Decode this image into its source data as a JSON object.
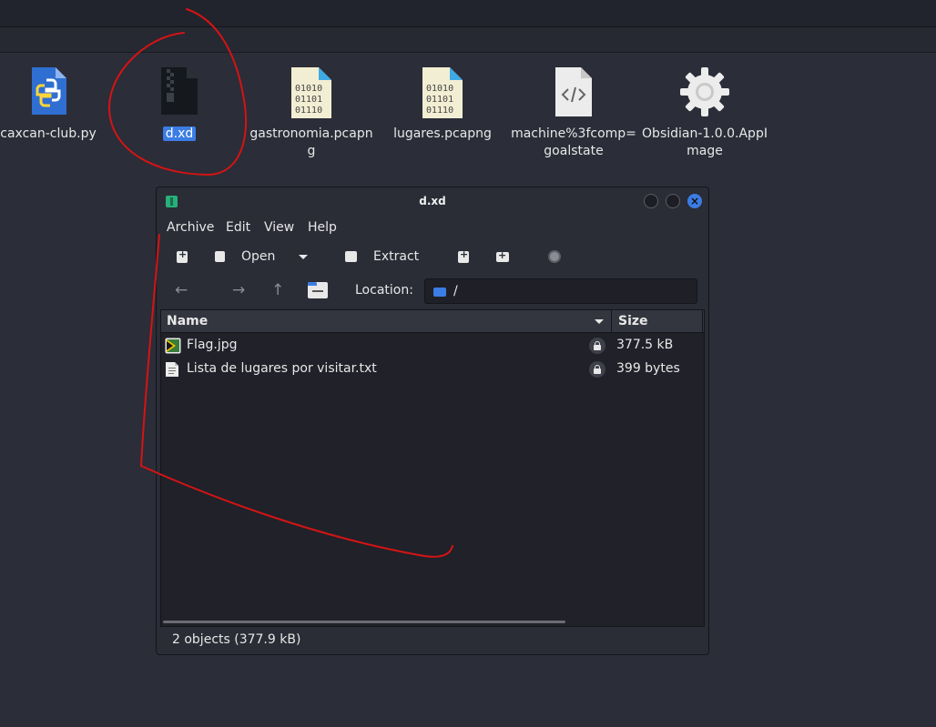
{
  "desktop": {
    "icons": [
      {
        "label": "caxcan-club.py",
        "icon": "python-file-icon"
      },
      {
        "label": "d.xd",
        "icon": "archive-file-icon",
        "selected": true
      },
      {
        "label": "gastronomia.pcapng",
        "icon": "binary-file-icon"
      },
      {
        "label": "lugares.pcapng",
        "icon": "binary-file-icon"
      },
      {
        "label": "machine%3fcomp=goalstate",
        "icon": "code-file-icon"
      },
      {
        "label": "Obsidian-1.0.0.AppImage",
        "icon": "gear-icon"
      }
    ]
  },
  "window": {
    "title": "d.xd",
    "menu": [
      "Archive",
      "Edit",
      "View",
      "Help"
    ],
    "toolbar": {
      "open_label": "Open",
      "extract_label": "Extract"
    },
    "location": {
      "label": "Location:",
      "path": "/"
    },
    "columns": {
      "name": "Name",
      "size": "Size"
    },
    "files": [
      {
        "name": "Flag.jpg",
        "size": "377.5 kB",
        "icon": "image-file-icon"
      },
      {
        "name": "Lista de lugares por visitar.txt",
        "size": "399 bytes",
        "icon": "text-file-icon"
      }
    ],
    "status": "2 objects (377.9 kB)"
  },
  "colors": {
    "accent": "#3b7de4",
    "annotation": "#d41414",
    "background": "#2b2d38"
  }
}
